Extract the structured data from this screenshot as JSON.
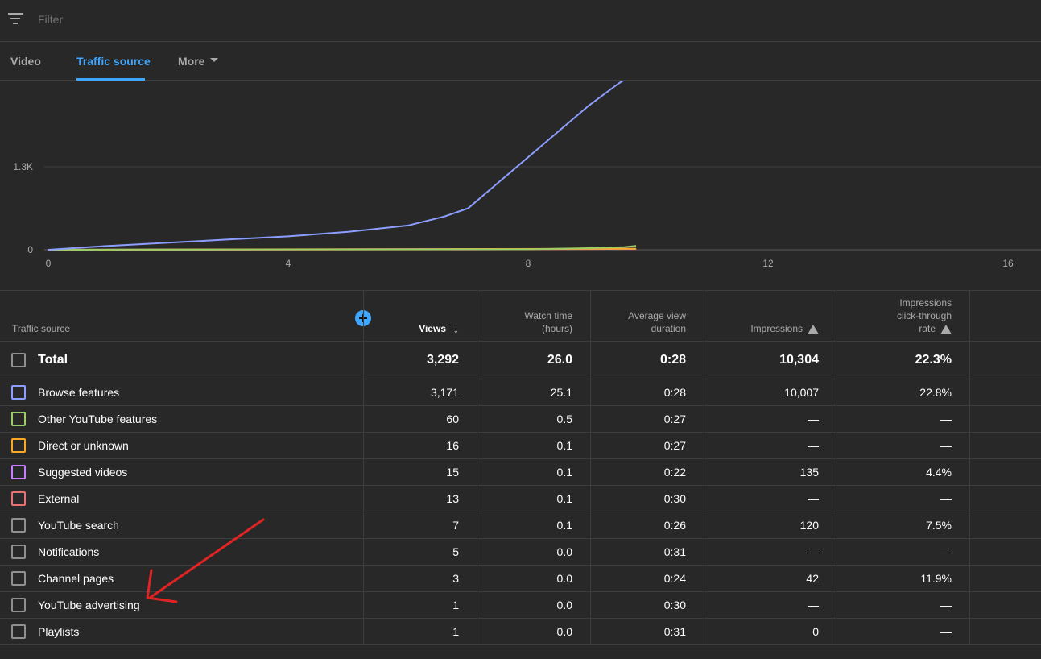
{
  "filter": {
    "placeholder": "Filter",
    "icon": "filter-icon"
  },
  "tabs": [
    {
      "label": "Video",
      "active": false
    },
    {
      "label": "Traffic source",
      "active": true
    },
    {
      "label": "More",
      "active": false
    }
  ],
  "chart_data": {
    "type": "line",
    "title": "",
    "xlabel": "",
    "ylabel": "",
    "x_ticks": [
      "0",
      "4",
      "8",
      "12",
      "16"
    ],
    "y_ticks": [
      "0",
      "1.3K"
    ],
    "xlim": [
      0,
      16
    ],
    "ylim": [
      0,
      2600
    ],
    "grid": true,
    "series": [
      {
        "color": "#8c9eff",
        "x": [
          0,
          1,
          2,
          3,
          4,
          5,
          6,
          6.6,
          7,
          7.5,
          8,
          8.5,
          9,
          9.5,
          9.7
        ],
        "y": [
          0,
          60,
          110,
          160,
          210,
          280,
          380,
          520,
          650,
          1050,
          1450,
          1850,
          2250,
          2600,
          2720
        ]
      },
      {
        "color": "#9ccc65",
        "x": [
          0,
          8,
          9,
          9.6,
          9.8
        ],
        "y": [
          0,
          8,
          25,
          40,
          60
        ]
      },
      {
        "color": "#f9a825",
        "x": [
          0,
          9.8
        ],
        "y": [
          0,
          16
        ]
      },
      {
        "color": "#c77dff",
        "x": [
          0,
          9.8
        ],
        "y": [
          0,
          15
        ]
      },
      {
        "color": "#e57373",
        "x": [
          0,
          7,
          9.8
        ],
        "y": [
          0,
          5,
          13
        ]
      }
    ]
  },
  "table": {
    "headers": {
      "source": "Traffic source",
      "views": "Views",
      "watch_l1": "Watch time",
      "watch_l2": "(hours)",
      "avg_l1": "Average view",
      "avg_l2": "duration",
      "impressions": "Impressions",
      "ctr_l1": "Impressions",
      "ctr_l2": "click-through",
      "ctr_l3": "rate"
    },
    "total": {
      "name": "Total",
      "views": "3,292",
      "watch": "26.0",
      "avg": "0:28",
      "impressions": "10,304",
      "ctr": "22.3%"
    },
    "rows": [
      {
        "name": "Browse features",
        "views": "3,171",
        "watch": "25.1",
        "avg": "0:28",
        "impressions": "10,007",
        "ctr": "22.8%",
        "color": "#8c9eff"
      },
      {
        "name": "Other YouTube features",
        "views": "60",
        "watch": "0.5",
        "avg": "0:27",
        "impressions": "—",
        "ctr": "—",
        "color": "#9ccc65"
      },
      {
        "name": "Direct or unknown",
        "views": "16",
        "watch": "0.1",
        "avg": "0:27",
        "impressions": "—",
        "ctr": "—",
        "color": "#f9a825"
      },
      {
        "name": "Suggested videos",
        "views": "15",
        "watch": "0.1",
        "avg": "0:22",
        "impressions": "135",
        "ctr": "4.4%",
        "color": "#c77dff"
      },
      {
        "name": "External",
        "views": "13",
        "watch": "0.1",
        "avg": "0:30",
        "impressions": "—",
        "ctr": "—",
        "color": "#e57373"
      },
      {
        "name": "YouTube search",
        "views": "7",
        "watch": "0.1",
        "avg": "0:26",
        "impressions": "120",
        "ctr": "7.5%",
        "color": "#909090"
      },
      {
        "name": "Notifications",
        "views": "5",
        "watch": "0.0",
        "avg": "0:31",
        "impressions": "—",
        "ctr": "—",
        "color": "#909090"
      },
      {
        "name": "Channel pages",
        "views": "3",
        "watch": "0.0",
        "avg": "0:24",
        "impressions": "42",
        "ctr": "11.9%",
        "color": "#909090"
      },
      {
        "name": "YouTube advertising",
        "views": "1",
        "watch": "0.0",
        "avg": "0:30",
        "impressions": "—",
        "ctr": "—",
        "color": "#909090"
      },
      {
        "name": "Playlists",
        "views": "1",
        "watch": "0.0",
        "avg": "0:31",
        "impressions": "0",
        "ctr": "—",
        "color": "#909090"
      }
    ]
  },
  "annotation": {
    "color": "#e02424"
  }
}
